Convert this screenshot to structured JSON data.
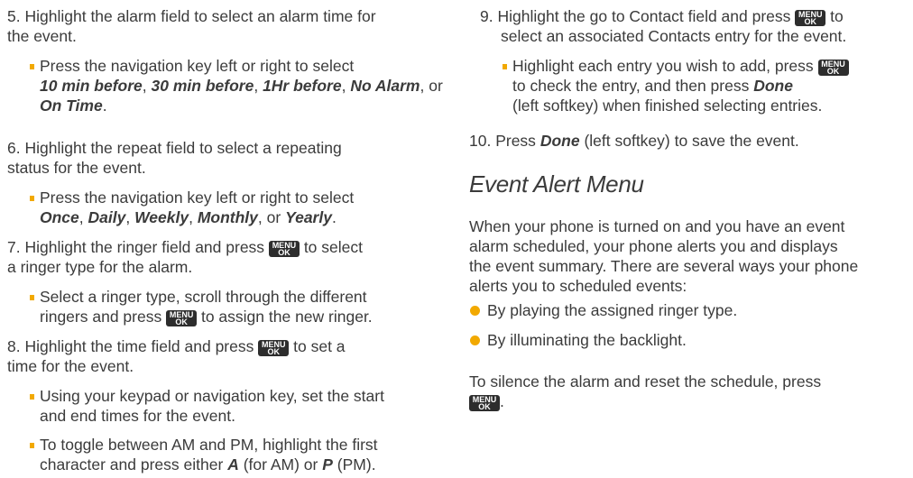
{
  "key_label_top": "MENU",
  "key_label_bottom": "OK",
  "left": {
    "s5": {
      "num": "5.",
      "a": "Highlight the alarm field to select an alarm time for",
      "b": "the event.",
      "sub_a": "Press the navigation key left or right to select",
      "o1": "10 min before",
      "o2": "30 min before",
      "o3": "1Hr before",
      "o4": "No Alarm",
      "or": ", or",
      "o5": "On Time",
      "end": "."
    },
    "s6": {
      "num": "6.",
      "a": "Highlight the repeat field to select a repeating",
      "b": "status for the event.",
      "sub_a": "Press the navigation key left or right to select",
      "o1": "Once",
      "o2": "Daily",
      "o3": "Weekly",
      "o4": "Monthly",
      "or": ", or",
      "o5": "Yearly",
      "end": "."
    },
    "s7": {
      "num": "7.",
      "a1": "Highlight the ringer field and press",
      "a2": "to select",
      "b": "a ringer type for the alarm.",
      "sub_a": "Select a ringer type, scroll through the different",
      "sub_b1": "ringers and press",
      "sub_b2": "to assign the new ringer."
    },
    "s8": {
      "num": "8.",
      "a1": "Highlight the time field and press",
      "a2": "to set a",
      "b": "time for the event.",
      "sub1_a": "Using your keypad or navigation key, set the start",
      "sub1_b": "and end times for the event.",
      "sub2_a": "To toggle between AM and PM, highlight the first",
      "sub2_b1": "character and press either",
      "sub2_A": "A",
      "sub2_b2": "(for AM) or",
      "sub2_P": "P",
      "sub2_b3": "(PM)."
    }
  },
  "right": {
    "s9": {
      "num": "9.",
      "a1": "Highlight the go to Contact field and press",
      "a2": "to",
      "b": "select an associated Contacts entry for the event.",
      "sub_a": "Highlight each entry you wish to add, press",
      "sub_b1": "to check the entry, and then press",
      "sub_done": "Done",
      "sub_c": "(left softkey) when finished selecting entries."
    },
    "s10": {
      "num": "10.",
      "a1": "Press",
      "done": "Done",
      "a2": "(left softkey) to save the event."
    },
    "heading": "Event Alert Menu",
    "para1": [
      "When your phone is turned on and you have an event",
      "alarm scheduled, your phone alerts you and displays",
      "the event summary. There are several ways your phone",
      "alerts you to scheduled events:"
    ],
    "bullets": [
      "By playing the assigned ringer type.",
      "By illuminating the backlight."
    ],
    "para2": "To silence the alarm and reset the schedule, press",
    "para2_end": "."
  },
  "colors": {
    "text": "#3b3b3b",
    "accent": "#f2a900",
    "key_bg": "#2d2d2d"
  }
}
